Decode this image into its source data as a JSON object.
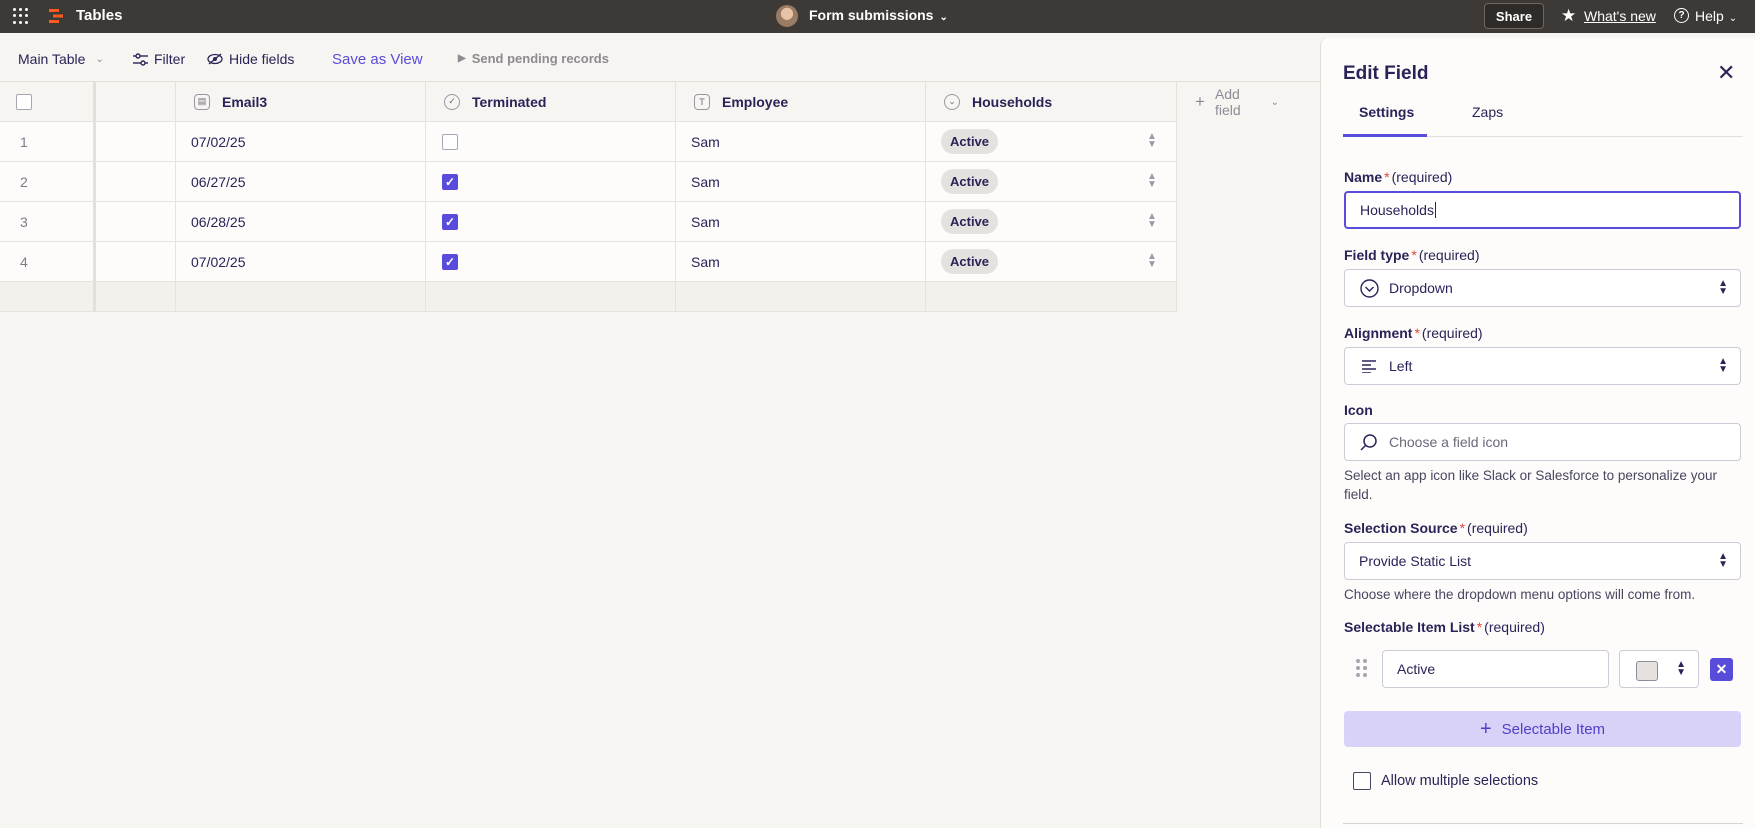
{
  "topbar": {
    "app_name": "Tables",
    "center_title": "Form submissions",
    "share_label": "Share",
    "whats_new_label": "What's new",
    "help_label": "Help"
  },
  "toolbar": {
    "view_label": "Main Table",
    "filter_label": "Filter",
    "hide_fields_label": "Hide fields",
    "save_as_view_label": "Save as View",
    "send_pending_label": "Send pending records"
  },
  "grid": {
    "columns": [
      {
        "label": "Email3",
        "icon": "calendar-icon"
      },
      {
        "label": "Terminated",
        "icon": "checkbox-circle-icon"
      },
      {
        "label": "Employee",
        "icon": "text-t-icon"
      },
      {
        "label": "Households",
        "icon": "dropdown-circle-icon"
      }
    ],
    "add_field_label": "Add field",
    "rows": [
      {
        "num": "1",
        "email3": "07/02/25",
        "terminated": false,
        "employee": "Sam",
        "households": "Active"
      },
      {
        "num": "2",
        "email3": "06/27/25",
        "terminated": true,
        "employee": "Sam",
        "households": "Active"
      },
      {
        "num": "3",
        "email3": "06/28/25",
        "terminated": true,
        "employee": "Sam",
        "households": "Active"
      },
      {
        "num": "4",
        "email3": "07/02/25",
        "terminated": true,
        "employee": "Sam",
        "households": "Active"
      }
    ]
  },
  "panel": {
    "title": "Edit Field",
    "tabs": [
      "Settings",
      "Zaps"
    ],
    "required_text": "(required)",
    "name_label": "Name",
    "name_value": "Households",
    "field_type_label": "Field type",
    "field_type_value": "Dropdown",
    "alignment_label": "Alignment",
    "alignment_value": "Left",
    "icon_label": "Icon",
    "icon_placeholder": "Choose a field icon",
    "icon_help": "Select an app icon like Slack or Salesforce to personalize your field.",
    "selection_source_label": "Selection Source",
    "selection_source_value": "Provide Static List",
    "selection_source_help": "Choose where the dropdown menu options will come from.",
    "item_list_label": "Selectable Item List",
    "items": [
      "Active"
    ],
    "add_item_label": "Selectable Item",
    "allow_multiple_label": "Allow multiple selections"
  },
  "colors": {
    "accent": "#5a4cdb",
    "topbar_bg": "#3d3936",
    "required_star": "#e0453a",
    "pill_bg": "#e4e1de",
    "add_item_bg": "#d8d2f9"
  }
}
